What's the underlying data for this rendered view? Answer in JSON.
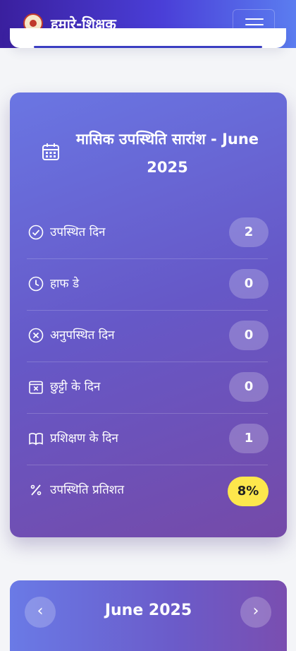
{
  "header": {
    "title": "हमारे-शिक्षक",
    "logo_icon": "emblem-logo",
    "menu_icon": "hamburger-menu-icon"
  },
  "summary": {
    "title": "मासिक उपस्थिति सारांश - June 2025",
    "icon": "calendar-icon",
    "stats": [
      {
        "label": "उपस्थित दिन",
        "value": "2",
        "icon": "check-circle-icon"
      },
      {
        "label": "हाफ डे",
        "value": "0",
        "icon": "clock-icon"
      },
      {
        "label": "अनुपस्थित दिन",
        "value": "0",
        "icon": "x-circle-icon"
      },
      {
        "label": "छुट्टी के दिन",
        "value": "0",
        "icon": "calendar-x-icon"
      },
      {
        "label": "प्रशिक्षण के दिन",
        "value": "1",
        "icon": "book-icon"
      },
      {
        "label": "उपस्थिति प्रतिशत",
        "value": "8%",
        "icon": "percent-icon"
      }
    ],
    "highlight_color": "#fde74c"
  },
  "calendar": {
    "month_label": "June 2025",
    "prev_icon": "chevron-left-icon",
    "next_icon": "chevron-right-icon"
  }
}
